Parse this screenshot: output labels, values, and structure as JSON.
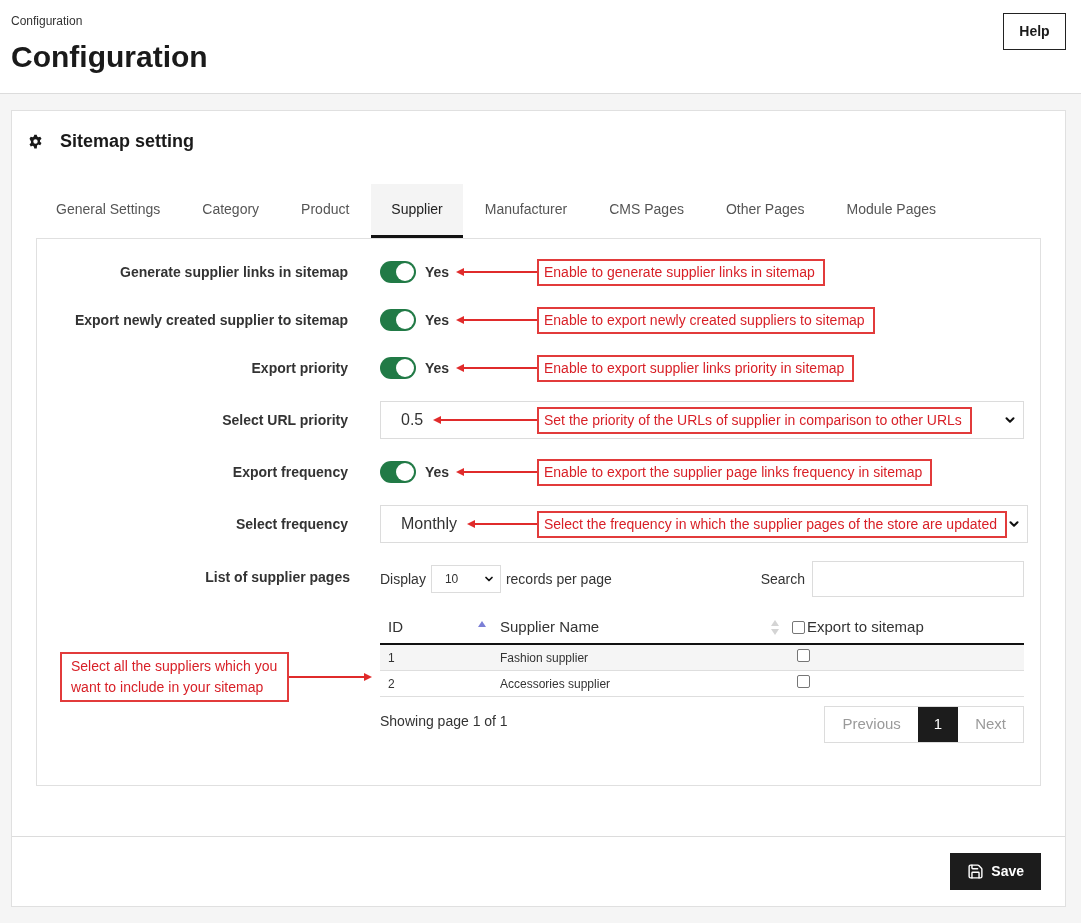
{
  "breadcrumb": "Configuration",
  "title": "Configuration",
  "help_button": "Help",
  "card": {
    "title": "Sitemap setting",
    "tabs": [
      {
        "label": "General Settings",
        "selected": false
      },
      {
        "label": "Category",
        "selected": false
      },
      {
        "label": "Product",
        "selected": false
      },
      {
        "label": "Supplier",
        "selected": true
      },
      {
        "label": "Manufacturer",
        "selected": false
      },
      {
        "label": "CMS Pages",
        "selected": false
      },
      {
        "label": "Other Pages",
        "selected": false
      },
      {
        "label": "Module Pages",
        "selected": false
      }
    ],
    "fields": [
      {
        "kind": "toggle",
        "label": "Generate supplier links in sitemap",
        "on": true,
        "value": "Yes",
        "annotation": "Enable to generate supplier links in sitemap"
      },
      {
        "kind": "toggle",
        "label": "Export newly created supplier to sitemap",
        "on": true,
        "value": "Yes",
        "annotation": "Enable to export newly created suppliers to sitemap"
      },
      {
        "kind": "toggle",
        "label": "Export priority",
        "on": true,
        "value": "Yes",
        "annotation": "Enable to export supplier links priority in sitemap"
      },
      {
        "kind": "select",
        "label": "Select URL priority",
        "value": "0.5",
        "annotation": "Set the priority of the URLs of supplier in comparison to other URLs"
      },
      {
        "kind": "toggle",
        "label": "Export frequency",
        "on": true,
        "value": "Yes",
        "annotation": "Enable to export the supplier page links frequency in sitemap"
      },
      {
        "kind": "select",
        "label": "Select frequency",
        "value": "Monthly",
        "annotation": "Select the frequency in which the supplier pages of the store are updated"
      }
    ],
    "supplier_list": {
      "label": "List of supplier pages",
      "annotation": "Select all the suppliers which you want to include in your sitemap",
      "display_label": "Display",
      "page_size": "10",
      "page_size_suffix": "records per page",
      "search_label": "Search",
      "columns": [
        {
          "kind": "sortable",
          "label": "ID",
          "sorted": true
        },
        {
          "kind": "sortable",
          "label": "Supplier Name",
          "sorted": false
        },
        {
          "kind": "checkbox",
          "label": "Export to sitemap",
          "checked": false
        }
      ],
      "rows": [
        {
          "id": "1",
          "name": "Fashion supplier",
          "checked": false
        },
        {
          "id": "2",
          "name": "Accessories supplier",
          "checked": false
        }
      ],
      "info": "Showing page 1 of 1",
      "pagination": [
        {
          "label": "Previous",
          "selected": false,
          "disabled": true
        },
        {
          "label": "1",
          "selected": true,
          "disabled": false
        },
        {
          "label": "Next",
          "selected": false,
          "disabled": true
        }
      ]
    },
    "save_button": "Save"
  }
}
